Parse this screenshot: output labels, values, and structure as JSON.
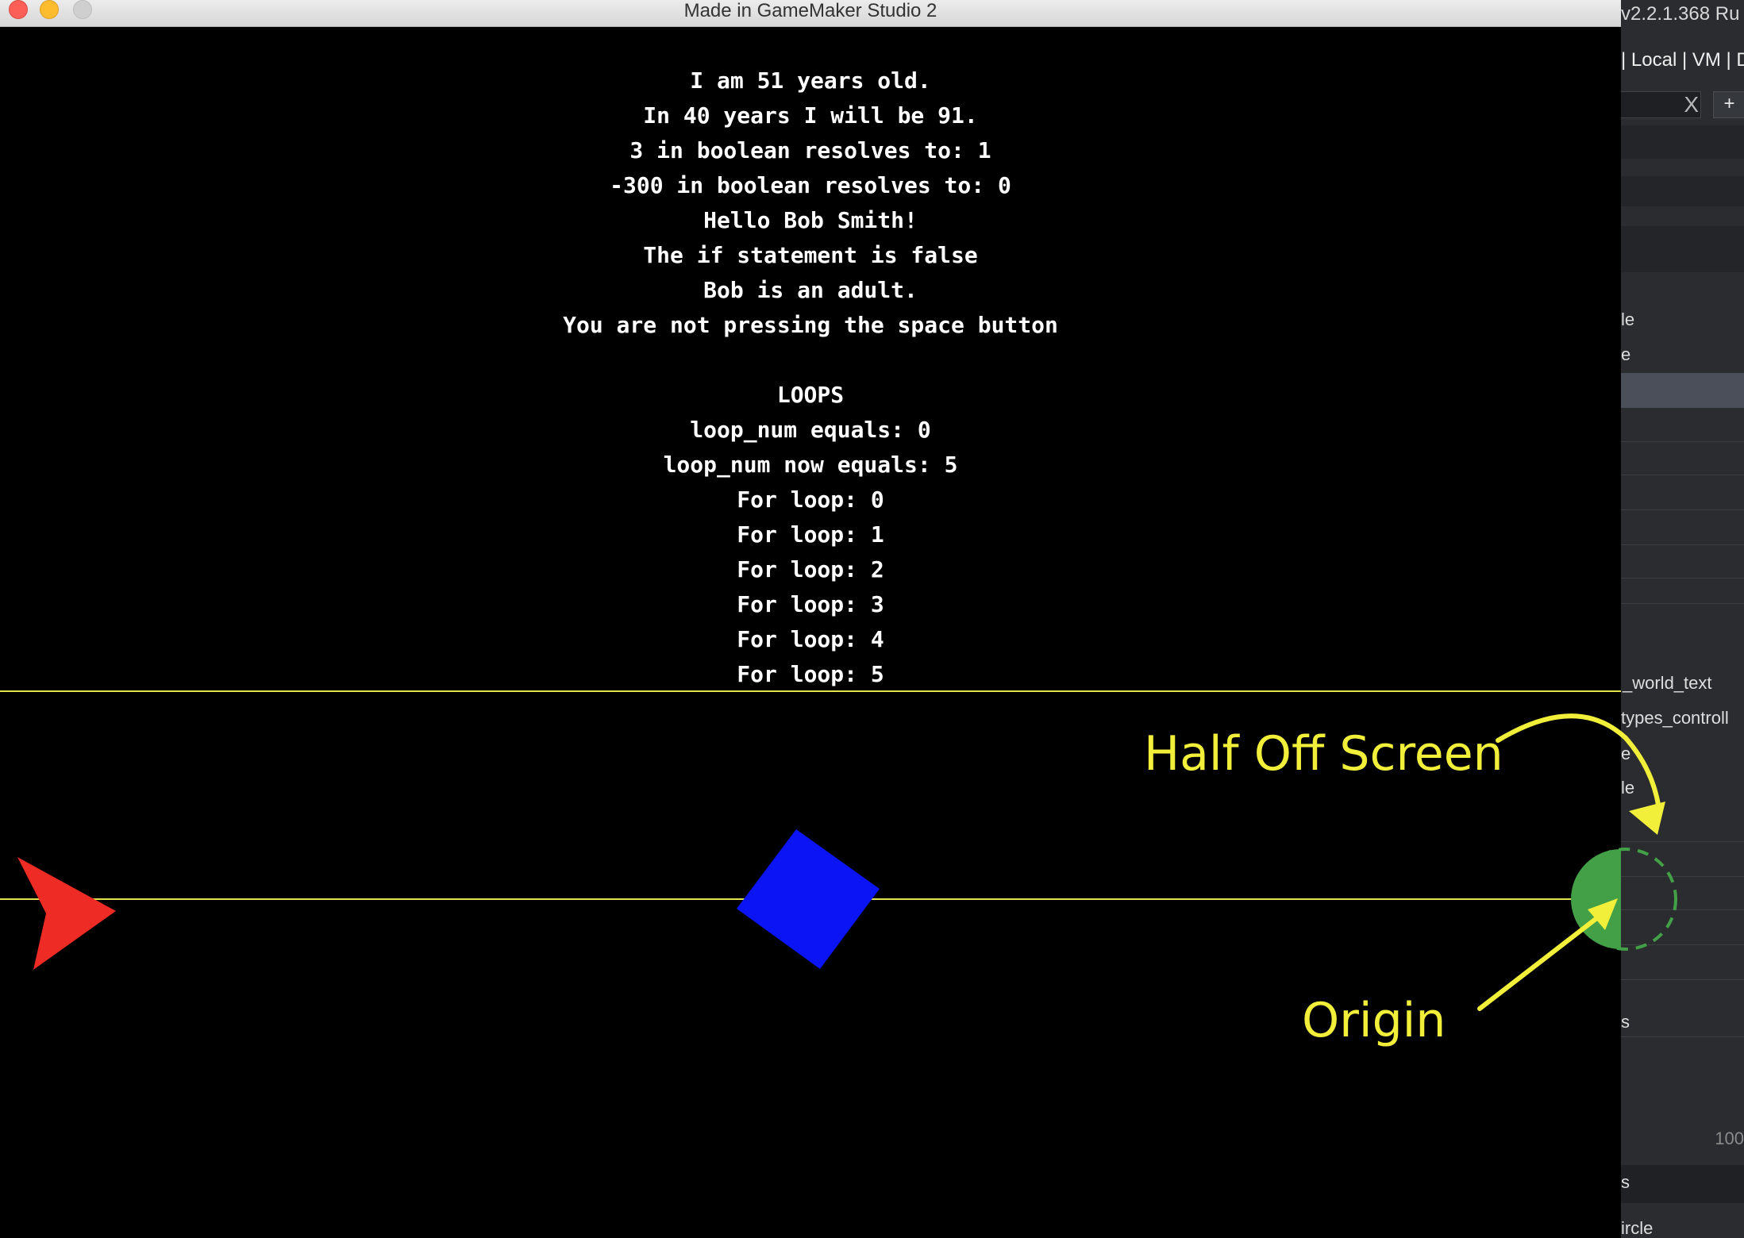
{
  "window": {
    "title": "Made in GameMaker Studio 2"
  },
  "console_lines": [
    "I am 51 years old.",
    "In 40 years I will be 91.",
    "3 in boolean resolves to: 1",
    "-300 in boolean resolves to: 0",
    "Hello Bob Smith!",
    "The if statement is false",
    "Bob is an adult.",
    "You are not pressing the space button",
    "",
    "LOOPS",
    "loop_num equals: 0",
    "loop_num now equals: 5",
    "For loop: 0",
    "For loop: 1",
    "For loop: 2",
    "For loop: 3",
    "For loop: 4",
    "For loop: 5"
  ],
  "annotations": {
    "half_off_screen": "Half Off Screen",
    "origin": "Origin"
  },
  "colors": {
    "annotation": "#f2ef3b",
    "guide_line": "#e3e34b",
    "red_arrow": "#ee2b24",
    "blue_square": "#0a14f5",
    "green_circle": "#43a047"
  },
  "ide": {
    "version": "v2.2.1.368  Ru",
    "target": "| Local | VM | D",
    "search_clear": "X",
    "add_button": "+",
    "rows": [
      "le",
      "e",
      "_world_text",
      "types_controll",
      "e",
      "le",
      "s",
      "s",
      "ircle"
    ],
    "footer_number": "100"
  }
}
